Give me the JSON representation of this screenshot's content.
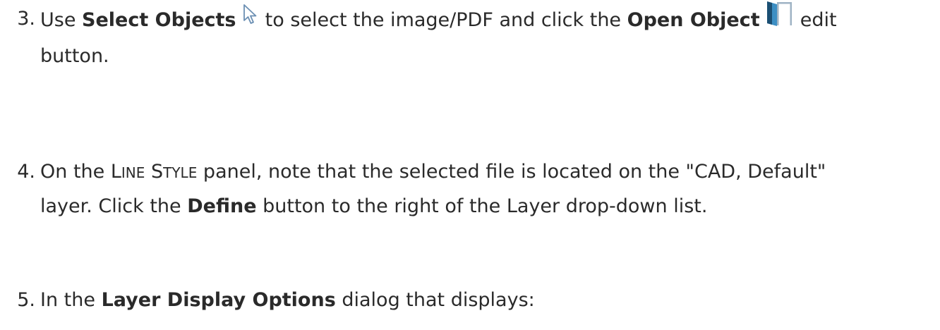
{
  "steps": [
    {
      "number": "3.",
      "t1": "Use ",
      "b1": "Select Objects",
      "t2": " to select the image/PDF and click the ",
      "b2": "Open Object",
      "t3": " edit",
      "line2": "button.",
      "icons": [
        "select-objects-arrow-icon",
        "open-object-door-icon"
      ]
    },
    {
      "number": "4.",
      "t1": "On the ",
      "sc1_big": "L",
      "sc1_small": "INE",
      "sc2_big": "S",
      "sc2_small": "TYLE",
      "t2": " panel, note that the selected file is located on the \"CAD, Default\"",
      "l2_t1": "layer. Click the ",
      "l2_b1": "Define",
      "l2_t2": " button to the right of the Layer drop-down list."
    },
    {
      "number": "5.",
      "t1": "In the ",
      "b1": "Layer Display Options",
      "t2": " dialog that displays:"
    }
  ],
  "colors": {
    "text": "#2a2a2a",
    "door_dark": "#1b4f73",
    "door_light": "#3d8fc4"
  }
}
